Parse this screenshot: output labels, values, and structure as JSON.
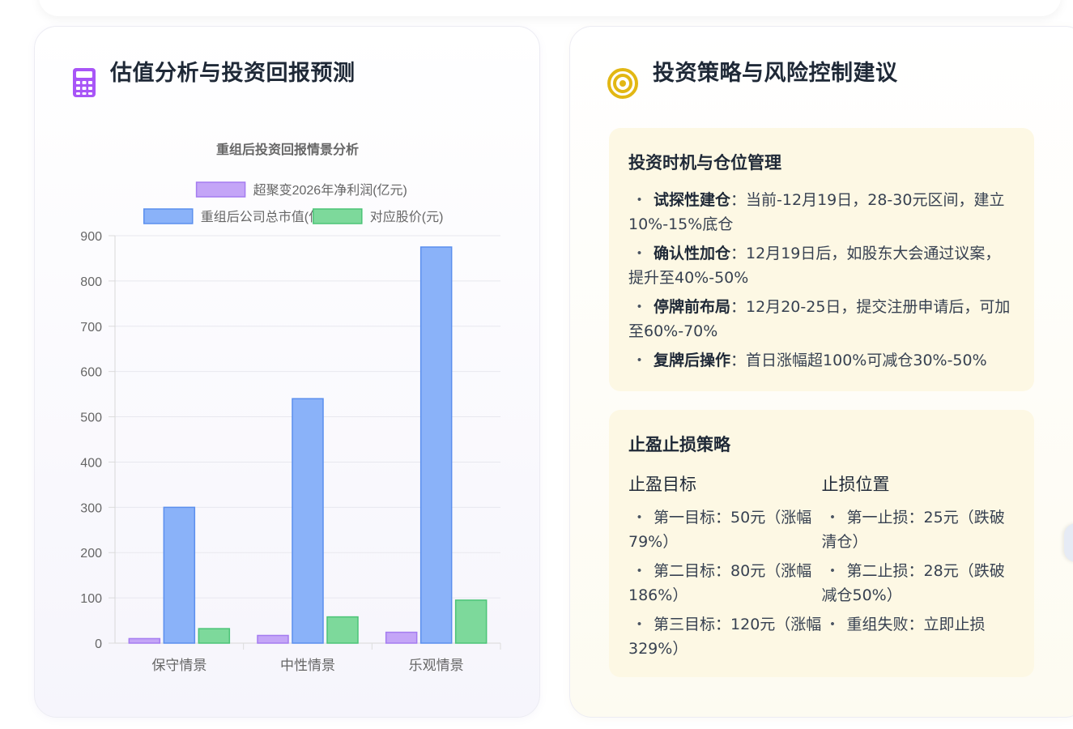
{
  "left_card": {
    "title": "估值分析与投资回报预测",
    "icon": "calculator-icon"
  },
  "chart_data": {
    "type": "bar",
    "title": "重组后投资回报情景分析",
    "categories": [
      "保守情景",
      "中性情景",
      "乐观情景"
    ],
    "series": [
      {
        "name": "超聚变2026年净利润(亿元)",
        "values": [
          10,
          17,
          24
        ],
        "color": "#c4a5f7",
        "border": "#a57cf0"
      },
      {
        "name": "重组后公司总市值(亿元)",
        "values": [
          300,
          540,
          875
        ],
        "color": "#8ab2f9",
        "border": "#5b8fee"
      },
      {
        "name": "对应股价(元)",
        "values": [
          32,
          58,
          95
        ],
        "color": "#7dd99b",
        "border": "#4cc477"
      }
    ],
    "ylim": [
      0,
      900
    ],
    "yticks": [
      0,
      100,
      200,
      300,
      400,
      500,
      600,
      700,
      800,
      900
    ],
    "legend": "top",
    "grid": true
  },
  "right_card": {
    "title": "投资策略与风险控制建议",
    "icon": "target-icon",
    "timing": {
      "heading": "投资时机与仓位管理",
      "bullet": "・",
      "items": [
        {
          "label": "试探性建仓",
          "text": "：当前-12月19日，28-30元区间，建立10%-15%底仓"
        },
        {
          "label": "确认性加仓",
          "text": "：12月19日后，如股东大会通过议案，提升至40%-50%"
        },
        {
          "label": "停牌前布局",
          "text": "：12月20-25日，提交注册申请后，可加至60%-70%"
        },
        {
          "label": "复牌后操作",
          "text": "：首日涨幅超100%可减仓30%-50%"
        }
      ]
    },
    "stop": {
      "heading": "止盈止损策略",
      "profit": {
        "heading": "止盈目标",
        "items": [
          "第一目标：50元（涨幅79%）",
          "第二目标：80元（涨幅186%）",
          "第三目标：120元（涨幅329%）"
        ]
      },
      "loss": {
        "heading": "止损位置",
        "items": [
          "第一止损：25元（跌破清仓）",
          "第二止损：28元（跌破减仓50%）",
          "重组失败：立即止损"
        ]
      }
    }
  }
}
